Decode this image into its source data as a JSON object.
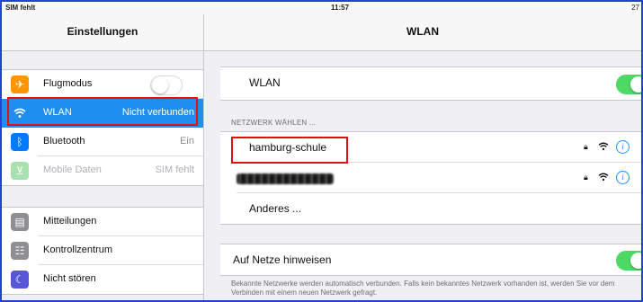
{
  "status": {
    "carrier": "SIM fehlt",
    "time": "11:57",
    "battery": "27"
  },
  "left": {
    "title": "Einstellungen",
    "items": [
      {
        "label": "Flugmodus",
        "value": "",
        "icon": "airplane-icon",
        "color": "#ff9500",
        "toggle": "off"
      },
      {
        "label": "WLAN",
        "value": "Nicht verbunden",
        "icon": "wifi-icon",
        "color": "#1f8ef1",
        "selected": true
      },
      {
        "label": "Bluetooth",
        "value": "Ein",
        "icon": "bluetooth-icon",
        "color": "#007aff"
      },
      {
        "label": "Mobile Daten",
        "value": "SIM fehlt",
        "icon": "antenna-icon",
        "color": "#4cd964",
        "dimmed": true
      },
      {
        "label": "Mitteilungen",
        "value": "",
        "icon": "notifications-icon",
        "color": "#8e8e93"
      },
      {
        "label": "Kontrollzentrum",
        "value": "",
        "icon": "control-center-icon",
        "color": "#8e8e93"
      },
      {
        "label": "Nicht stören",
        "value": "",
        "icon": "moon-icon",
        "color": "#5856d6"
      }
    ]
  },
  "right": {
    "title": "WLAN",
    "wlan_label": "WLAN",
    "wlan_toggle": "on",
    "section_title": "NETZWERK WÄHLEN ...",
    "networks": [
      {
        "name": "hamburg-schule",
        "secured": true
      },
      {
        "name": "",
        "secured": true,
        "obscured": true
      }
    ],
    "other_label": "Anderes ...",
    "ask_label": "Auf Netze hinweisen",
    "ask_toggle": "on",
    "footnote": "Bekannte Netzwerke werden automatisch verbunden. Falls kein bekanntes Netzwerk vorhanden ist, werden Sie vor dem Verbinden mit einem neuen Netzwerk gefragt."
  },
  "colors": {
    "accent": "#1f8ef1",
    "toggle_on": "#4cd964",
    "highlight_box": "#e01010",
    "frame": "#2244cc"
  }
}
